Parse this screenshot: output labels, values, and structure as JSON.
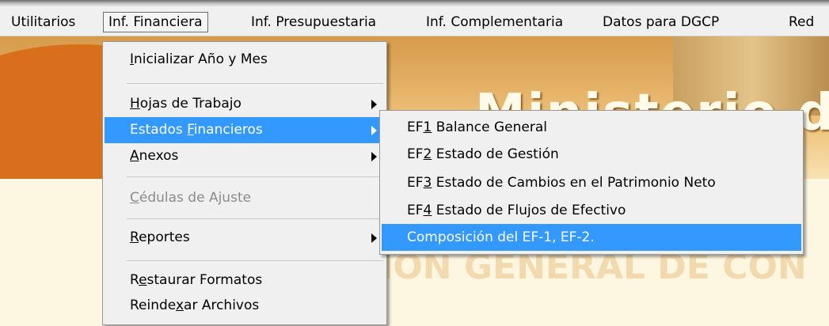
{
  "menubar": {
    "items": [
      {
        "label": "Utilitarios"
      },
      {
        "label": "Inf. Financiera"
      },
      {
        "label": "Inf. Presupuestaria"
      },
      {
        "label": "Inf. Complementaria"
      },
      {
        "label": "Datos para DGCP"
      },
      {
        "label": "Red"
      }
    ]
  },
  "menu": {
    "items": [
      {
        "pre": "",
        "key": "I",
        "post": "nicializar Año y Mes"
      },
      {
        "pre": "",
        "key": "H",
        "post": "ojas de Trabajo"
      },
      {
        "pre": "Estados ",
        "key": "F",
        "post": "inancieros"
      },
      {
        "pre": "",
        "key": "A",
        "post": "nexos"
      },
      {
        "pre": "",
        "key": "C",
        "post": "édulas de Ajuste"
      },
      {
        "pre": "",
        "key": "R",
        "post": "eportes"
      },
      {
        "pre": "R",
        "key": "e",
        "post": "staurar Formatos"
      },
      {
        "pre": "Reinde",
        "key": "x",
        "post": "ar Archivos"
      }
    ]
  },
  "submenu": {
    "items": [
      {
        "pre": "EF",
        "key": "1",
        "post": " Balance General"
      },
      {
        "pre": "EF",
        "key": "2",
        "post": " Estado de Gestión"
      },
      {
        "pre": "EF",
        "key": "3",
        "post": " Estado de Cambios en el Patrimonio Neto"
      },
      {
        "pre": "EF",
        "key": "4",
        "post": " Estado de Flujos de Efectivo"
      },
      {
        "pre": "Composición del EF-1, EF-2.",
        "key": "",
        "post": ""
      }
    ]
  },
  "colors": {
    "highlight": "#3399ff",
    "menu_bg": "#f0f0f0",
    "disabled_text": "#8b8b8b"
  }
}
